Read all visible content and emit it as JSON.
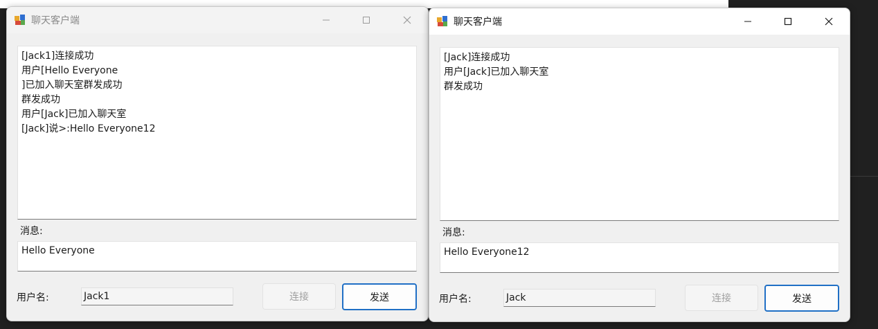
{
  "windows": [
    {
      "title": "聊天客户端",
      "chat_lines": [
        "[Jack1]连接成功",
        "用户[Hello Everyone",
        "]已加入聊天室群发成功",
        "群发成功",
        "用户[Jack]已加入聊天室",
        "[Jack]说>:Hello Everyone12"
      ],
      "message_label": "消息:",
      "message_value": "Hello Everyone",
      "username_label": "用户名:",
      "username_value": "Jack1",
      "connect_label": "连接",
      "send_label": "发送"
    },
    {
      "title": "聊天客户端",
      "chat_lines": [
        "[Jack]连接成功",
        "用户[Jack]已加入聊天室",
        "群发成功"
      ],
      "message_label": "消息:",
      "message_value": "Hello Everyone12",
      "username_label": "用户名:",
      "username_value": "Jack",
      "connect_label": "连接",
      "send_label": "发送"
    }
  ],
  "colors": {
    "accent": "#1f6fc5",
    "desktop": "#202020",
    "window_bg": "#f0f0f0"
  },
  "icons": [
    "app-icon",
    "minimize-icon",
    "maximize-icon",
    "close-icon"
  ]
}
